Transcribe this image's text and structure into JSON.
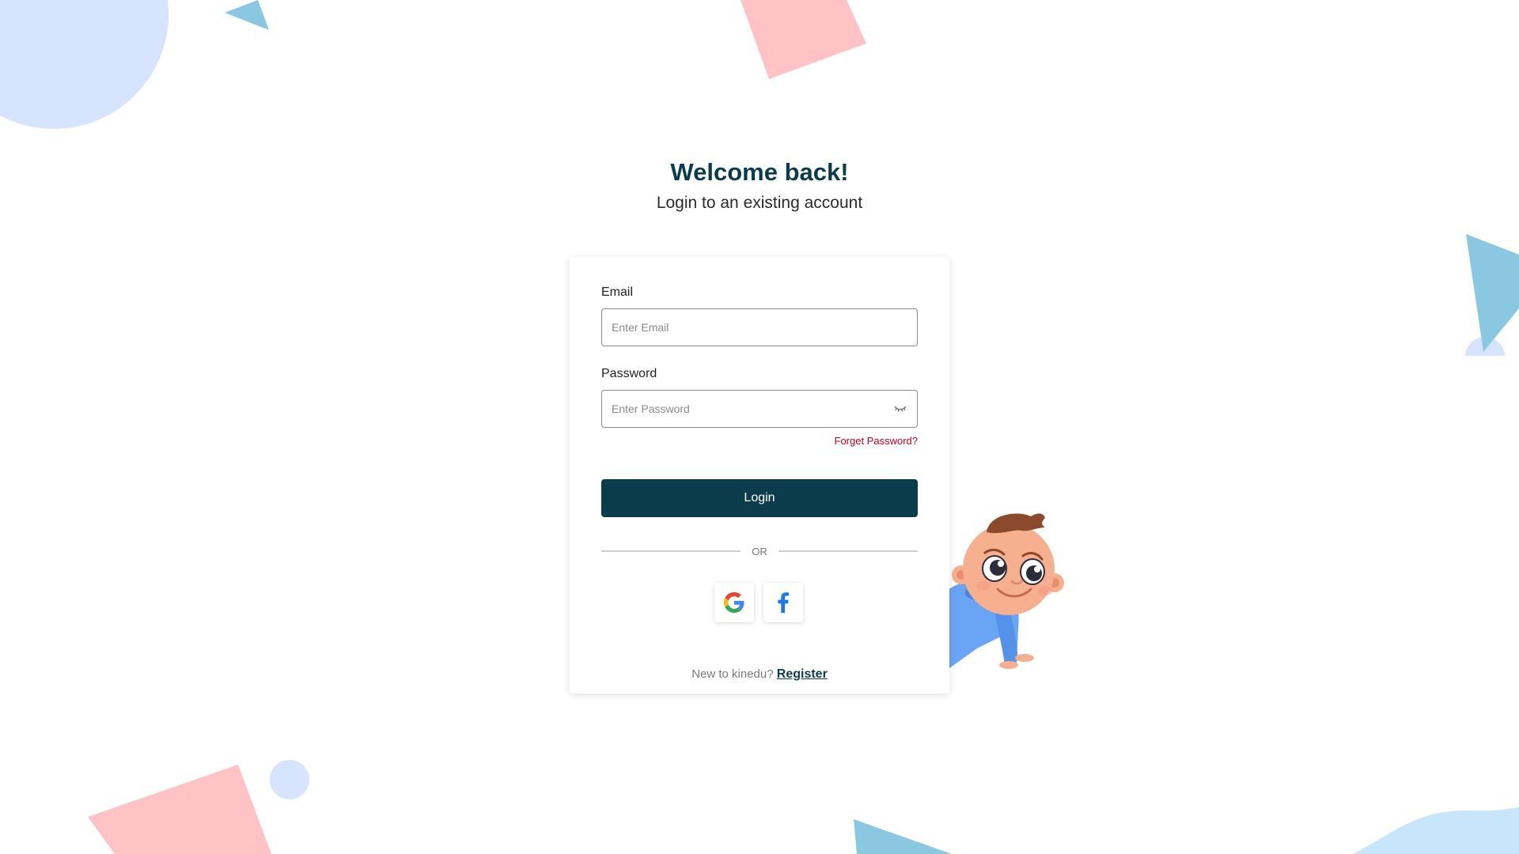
{
  "header": {
    "title": "Welcome back!",
    "subtitle": "Login to an existing account"
  },
  "form": {
    "email_label": "Email",
    "email_placeholder": "Enter Email",
    "email_value": "",
    "password_label": "Password",
    "password_placeholder": "Enter Password",
    "password_value": "",
    "forgot_password": "Forget Password?",
    "login_button": "Login",
    "divider_text": "OR"
  },
  "social": {
    "google_icon": "google-icon",
    "facebook_icon": "facebook-icon"
  },
  "footer": {
    "prompt": "New to kinedu?",
    "register_link": "Register"
  },
  "colors": {
    "brand_dark": "#0b3c4c",
    "error_red": "#c3001c",
    "deco_blue": "#d6e4fd",
    "deco_pink": "#ffc3c6",
    "deco_teal": "#89c8e0"
  }
}
